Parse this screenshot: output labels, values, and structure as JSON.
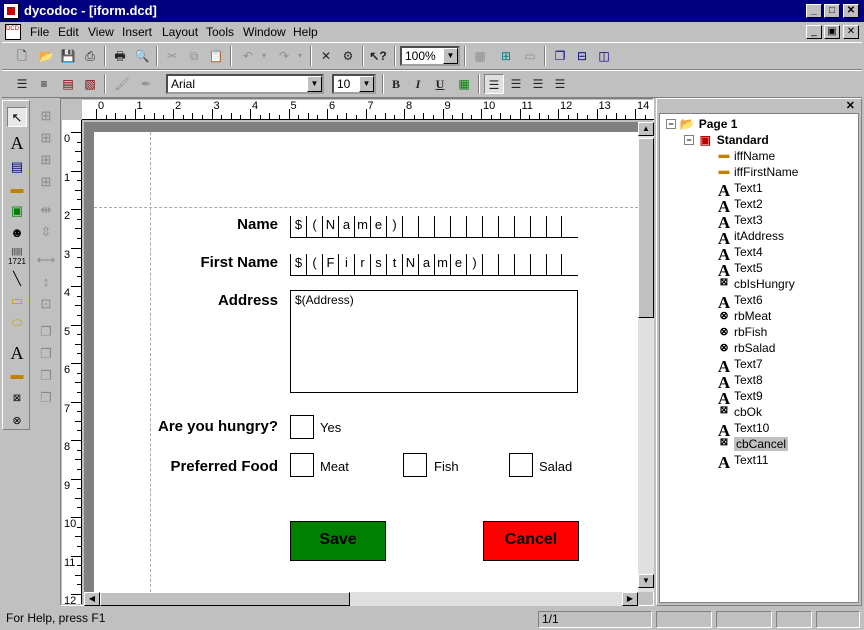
{
  "window": {
    "title": "dycodoc - [iform.dcd]"
  },
  "menu": [
    "File",
    "Edit",
    "View",
    "Insert",
    "Layout",
    "Tools",
    "Window",
    "Help"
  ],
  "toolbar1": {
    "zoom": "100%"
  },
  "toolbar2": {
    "font": "Arial",
    "size": "10",
    "bold": "B",
    "italic": "I",
    "underline": "U"
  },
  "rulers": {
    "h": [
      "0",
      "1",
      "2",
      "3",
      "4",
      "5",
      "6",
      "7",
      "8",
      "9",
      "10",
      "11",
      "12",
      "13",
      "14"
    ],
    "v": [
      "0",
      "1",
      "2",
      "3",
      "4",
      "5",
      "6",
      "7",
      "8",
      "9",
      "10",
      "11",
      "12"
    ]
  },
  "form": {
    "name_label": "Name",
    "name_cells": [
      "$",
      "(",
      "N",
      "a",
      "m",
      "e",
      ")",
      "",
      "",
      "",
      "",
      "",
      "",
      "",
      "",
      "",
      ""
    ],
    "first_label": "First Name",
    "first_cells": [
      "$",
      "(",
      "F",
      "i",
      "r",
      "s",
      "t",
      "N",
      "a",
      "m",
      "e",
      ")",
      "",
      "",
      "",
      "",
      ""
    ],
    "address_label": "Address",
    "address_value": "$(Address)",
    "hungry_label": "Are you hungry?",
    "yes_label": "Yes",
    "food_label": "Preferred Food",
    "meat_label": "Meat",
    "fish_label": "Fish",
    "salad_label": "Salad",
    "save_label": "Save",
    "cancel_label": "Cancel",
    "save_color": "#008000",
    "cancel_color": "#ff0000"
  },
  "tree": {
    "page": "Page 1",
    "group": "Standard",
    "items": [
      {
        "label": "iffName",
        "icon": "field"
      },
      {
        "label": "iffFirstName",
        "icon": "field"
      },
      {
        "label": "Text1",
        "icon": "text"
      },
      {
        "label": "Text2",
        "icon": "text"
      },
      {
        "label": "Text3",
        "icon": "text"
      },
      {
        "label": "itAddress",
        "icon": "text"
      },
      {
        "label": "Text4",
        "icon": "text"
      },
      {
        "label": "Text5",
        "icon": "text"
      },
      {
        "label": "cbIsHungry",
        "icon": "checkbox"
      },
      {
        "label": "Text6",
        "icon": "text"
      },
      {
        "label": "rbMeat",
        "icon": "radio"
      },
      {
        "label": "rbFish",
        "icon": "radio"
      },
      {
        "label": "rbSalad",
        "icon": "radio"
      },
      {
        "label": "Text7",
        "icon": "text"
      },
      {
        "label": "Text8",
        "icon": "text"
      },
      {
        "label": "Text9",
        "icon": "text"
      },
      {
        "label": "cbOk",
        "icon": "checkbox"
      },
      {
        "label": "Text10",
        "icon": "text"
      },
      {
        "label": "cbCancel",
        "icon": "checkbox",
        "selected": true
      },
      {
        "label": "Text11",
        "icon": "text"
      }
    ]
  },
  "status": {
    "help": "For Help, press F1",
    "page": "1/1"
  }
}
